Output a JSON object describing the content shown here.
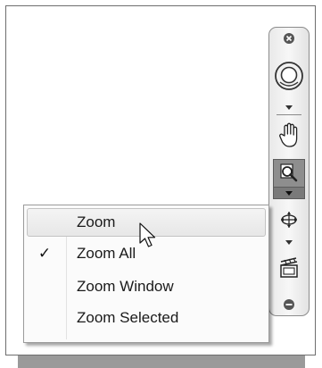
{
  "icons": {
    "navbar_close": "close-icon",
    "steering_wheel": "steering-wheel-icon",
    "pan": "pan-hand-icon",
    "zoom": "zoom-magnifier-icon",
    "orbit": "orbit-icon",
    "showmotion": "showmotion-icon",
    "settings": "settings-circle-icon",
    "dropdown": "triangle-down-icon",
    "cursor": "mouse-pointer-icon"
  },
  "menu": {
    "items": [
      {
        "label": "Zoom",
        "checked": false,
        "hovered": true
      },
      {
        "label": "Zoom All",
        "checked": true,
        "hovered": false
      },
      {
        "label": "Zoom Window",
        "checked": false,
        "hovered": false
      },
      {
        "label": "Zoom Selected",
        "checked": false,
        "hovered": false
      }
    ],
    "check_mark": "✓"
  }
}
